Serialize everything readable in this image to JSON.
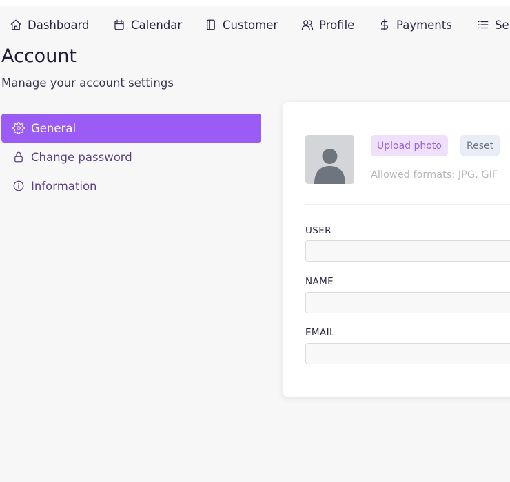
{
  "topnav": {
    "items": [
      {
        "label": "Dashboard",
        "icon": "home-icon"
      },
      {
        "label": "Calendar",
        "icon": "calendar-icon"
      },
      {
        "label": "Customer",
        "icon": "notebook-icon"
      },
      {
        "label": "Profile",
        "icon": "users-icon"
      },
      {
        "label": "Payments",
        "icon": "dollar-icon"
      },
      {
        "label": "Ser",
        "icon": "list-icon"
      }
    ]
  },
  "page": {
    "title": "Account",
    "subtitle": "Manage your account settings"
  },
  "sidebar": {
    "items": [
      {
        "label": "General",
        "icon": "gear-icon",
        "active": true
      },
      {
        "label": "Change password",
        "icon": "lock-icon",
        "active": false
      },
      {
        "label": "Information",
        "icon": "info-icon",
        "active": false
      }
    ]
  },
  "profile": {
    "upload_label": "Upload photo",
    "reset_label": "Reset",
    "formats_text": "Allowed formats: JPG, GIF"
  },
  "form": {
    "user_label": "USER",
    "user_value": "",
    "name_label": "NAME",
    "name_value": "",
    "email_label": "EMAIL",
    "email_value": ""
  },
  "colors": {
    "accent": "#9a5cf5",
    "background": "#f7f7f8",
    "upload_button_bg": "#efe0fb",
    "reset_button_bg": "#e9eef6"
  }
}
